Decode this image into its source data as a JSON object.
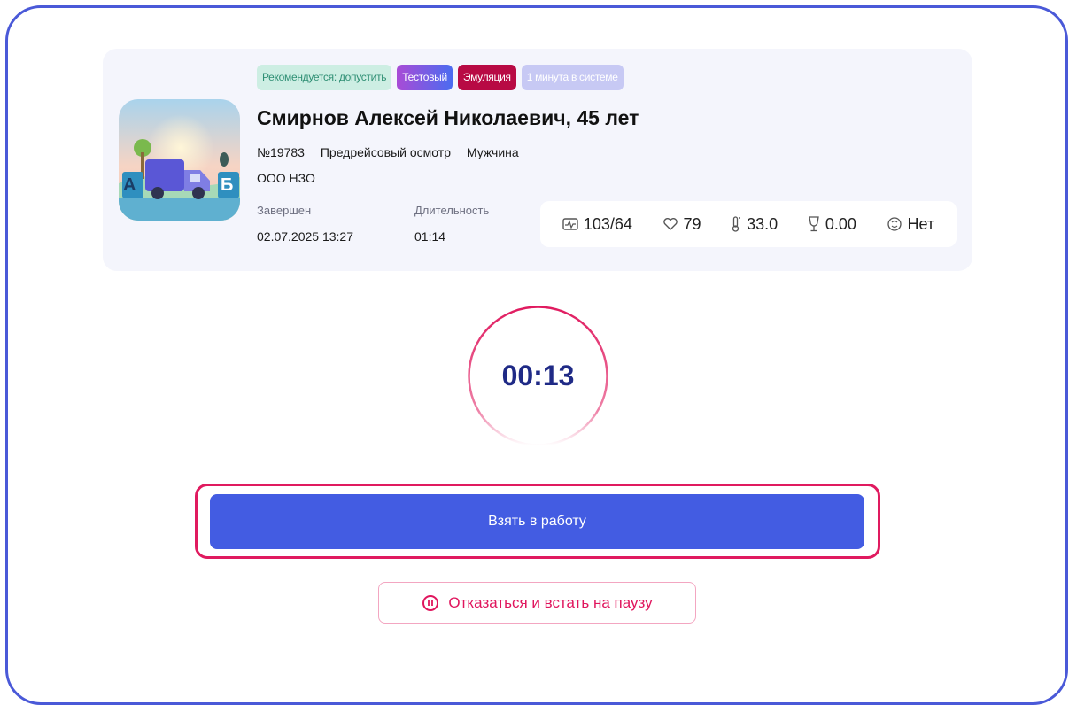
{
  "patient": {
    "tags": [
      {
        "label": "Рекомендуется: допустить"
      },
      {
        "label": "Тестовый"
      },
      {
        "label": "Эмуляция"
      },
      {
        "label": "1 минута в системе"
      }
    ],
    "name": "Смирнов Алексей Николаевич, 45 лет",
    "number": "№19783",
    "exam_type": "Предрейсовый осмотр",
    "gender": "Мужчина",
    "organization": "ООО НЗО",
    "completed_label": "Завершен",
    "completed_value": "02.07.2025  13:27",
    "duration_label": "Длительность",
    "duration_value": "01:14",
    "thumbnail": {
      "left_label": "А",
      "right_label": "Б",
      "icon": "truck-route-icon"
    }
  },
  "vitals": {
    "pressure": "103/64",
    "pulse": "79",
    "temperature": "33.0",
    "alcohol": "0.00",
    "drugs": "Нет"
  },
  "timer": {
    "value": "00:13",
    "accent": "#e01a5f"
  },
  "actions": {
    "take_label": "Взять в работу",
    "pause_label": "Отказаться и встать на паузу"
  },
  "colors": {
    "primary": "#435ce2",
    "danger": "#e01a5f",
    "frame": "#4a59d8"
  }
}
